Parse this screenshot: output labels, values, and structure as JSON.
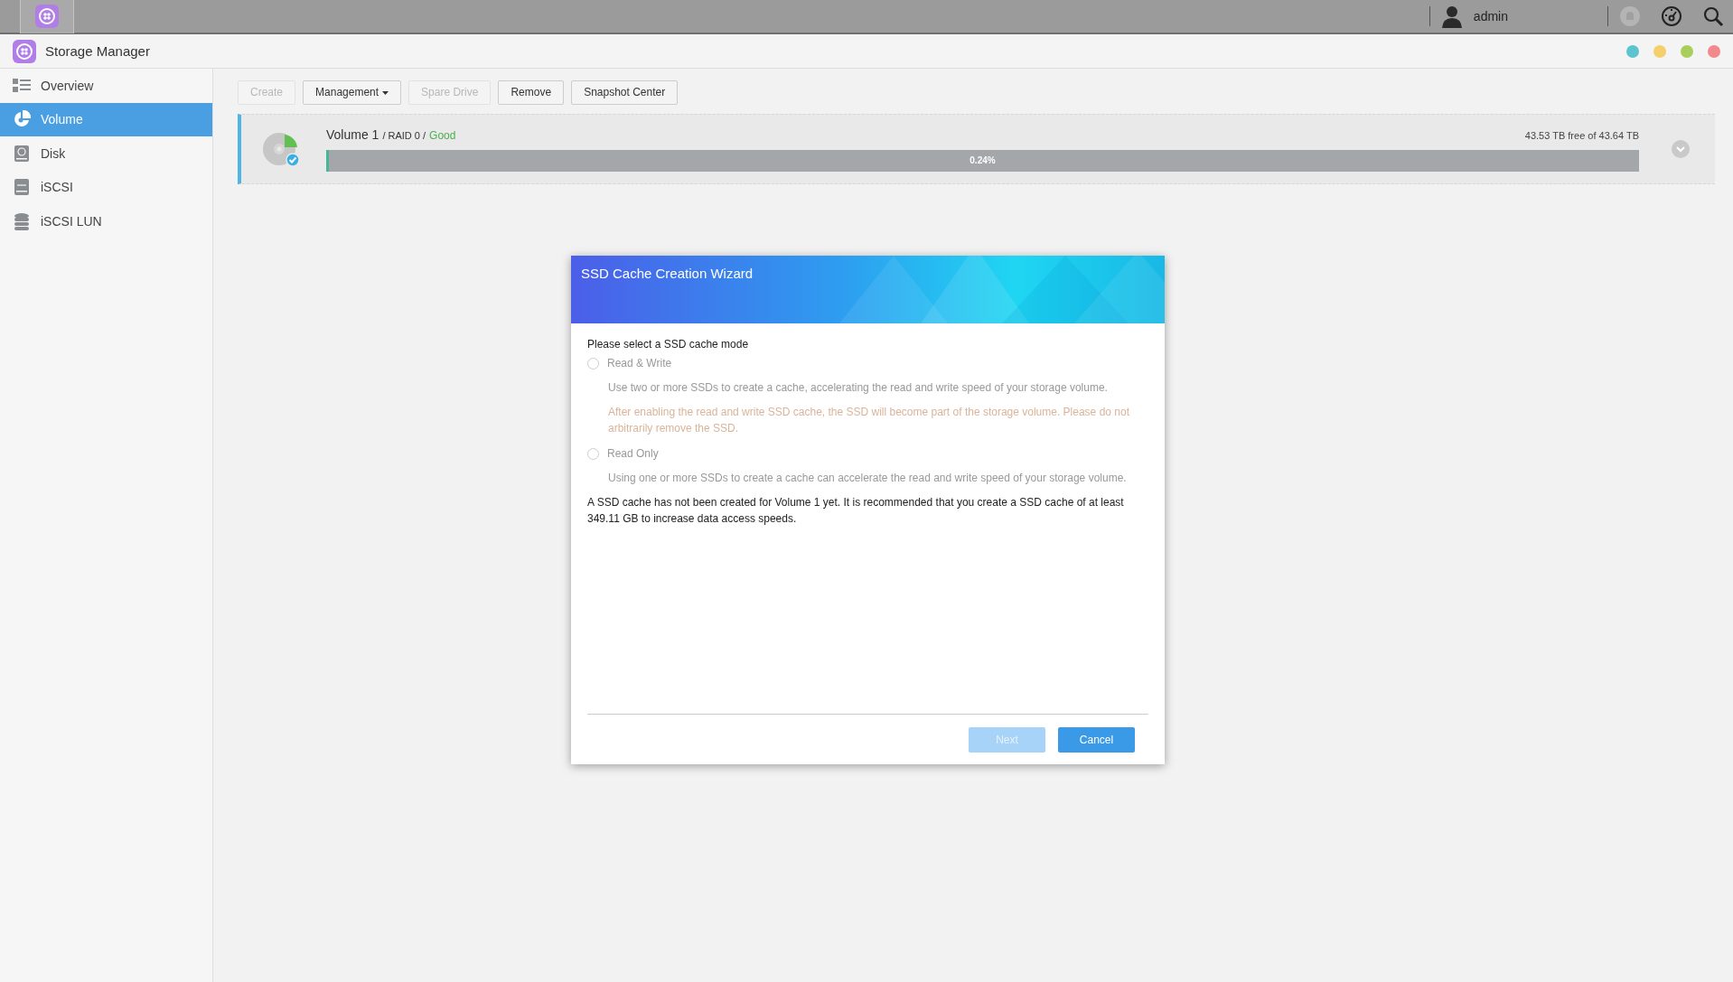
{
  "top_bar": {
    "user": "admin"
  },
  "window": {
    "title": "Storage Manager",
    "controls": [
      {
        "color": "#5bc4cf"
      },
      {
        "color": "#f4cf6c"
      },
      {
        "color": "#a9cf5a"
      },
      {
        "color": "#f2898c"
      }
    ]
  },
  "sidebar": {
    "items": [
      {
        "label": "Overview",
        "selected": false
      },
      {
        "label": "Volume",
        "selected": true
      },
      {
        "label": "Disk",
        "selected": false
      },
      {
        "label": "iSCSI",
        "selected": false
      },
      {
        "label": "iSCSI LUN",
        "selected": false
      }
    ]
  },
  "toolbar": [
    {
      "label": "Create",
      "disabled": true,
      "dropdown": false
    },
    {
      "label": "Management",
      "disabled": false,
      "dropdown": true
    },
    {
      "label": "Spare Drive",
      "disabled": true,
      "dropdown": false
    },
    {
      "label": "Remove",
      "disabled": false,
      "dropdown": false
    },
    {
      "label": "Snapshot Center",
      "disabled": false,
      "dropdown": false
    }
  ],
  "volume": {
    "name": "Volume 1",
    "detail": "/ RAID 0 /",
    "status": "Good",
    "capacity": "43.53 TB free of 43.64 TB",
    "usage": {
      "level": 0.0024,
      "reading": "0.24%"
    }
  },
  "dialog": {
    "title": "SSD Cache Creation Wizard",
    "prompt": "Please select a SSD cache mode",
    "options": [
      {
        "label": "Read & Write",
        "selected": false,
        "disabled": true,
        "description": "Use two or more SSDs to create a cache, accelerating the read and write speed of your storage volume.",
        "warning": "After enabling the read and write SSD cache, the SSD will become part of the storage volume. Please do not arbitrarily remove the SSD."
      },
      {
        "label": "Read Only",
        "selected": false,
        "disabled": true,
        "description": "Using one or more SSDs to create a cache can accelerate the read and write speed of your storage volume."
      }
    ],
    "note": "A SSD cache has not been created for Volume 1 yet. It is recommended that you create a SSD cache of at least 349.11 GB to increase data access speeds.",
    "buttons": [
      {
        "label": "Next",
        "disabled": true
      },
      {
        "label": "Cancel",
        "disabled": false
      }
    ]
  }
}
